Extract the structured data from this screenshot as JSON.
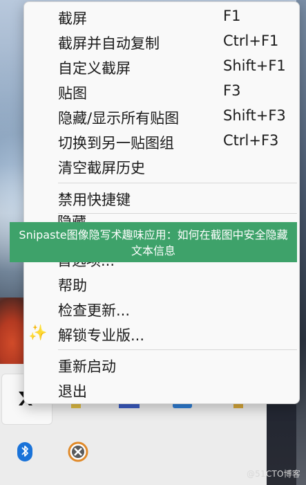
{
  "menu": {
    "items": [
      {
        "label": "截屏",
        "shortcut": "F1"
      },
      {
        "label": "截屏并自动复制",
        "shortcut": "Ctrl+F1"
      },
      {
        "label": "自定义截屏",
        "shortcut": "Shift+F1"
      },
      {
        "label": "贴图",
        "shortcut": "F3"
      },
      {
        "label": "隐藏/显示所有贴图",
        "shortcut": "Shift+F3"
      },
      {
        "label": "切换到另一贴图组",
        "shortcut": "Ctrl+F3"
      },
      {
        "label": "清空截屏历史",
        "shortcut": ""
      },
      {
        "label": "禁用快捷键",
        "shortcut": ""
      },
      {
        "label": "帮助",
        "shortcut": ""
      },
      {
        "label": "检查更新...",
        "shortcut": ""
      },
      {
        "label": "解锁专业版...",
        "shortcut": "",
        "icon": "sparkles-icon"
      },
      {
        "label": "重新启动",
        "shortcut": ""
      },
      {
        "label": "退出",
        "shortcut": ""
      }
    ],
    "obscured_top_fragment": "隐藏",
    "obscured_bottom_fragment": "首选项..."
  },
  "banner": {
    "text": "Snipaste图像隐写术趣味应用：如何在截图中安全隐藏文本信息",
    "color": "#3ea26a"
  },
  "tray": {
    "icons": [
      "snipaste-icon",
      "bluetooth-icon",
      "app-x-icon"
    ]
  },
  "watermark": {
    "text": "@51CTO博客"
  }
}
